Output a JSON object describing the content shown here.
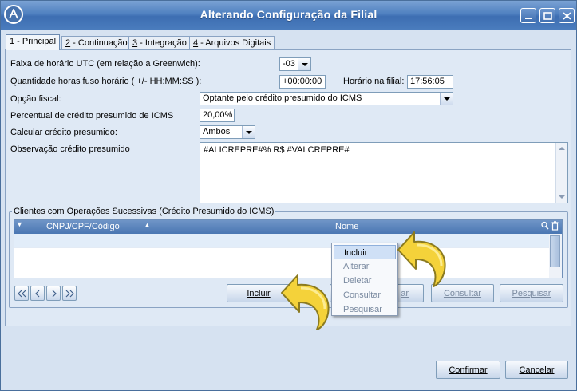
{
  "window": {
    "title": "Alterando Configuração da Filial"
  },
  "tabs": [
    {
      "key": "1",
      "label": " - Principal",
      "active": true
    },
    {
      "key": "2",
      "label": " - Continuação",
      "active": false
    },
    {
      "key": "3",
      "label": " - Integração",
      "active": false
    },
    {
      "key": "4",
      "label": " - Arquivos Digitais",
      "active": false
    }
  ],
  "form": {
    "utc_label": "Faixa de horário UTC (em relação a Greenwich):",
    "utc_value": "-03",
    "fuso_label": "Quantidade horas fuso horário ( +/- HH:MM:SS ):",
    "fuso_value": "+00:00:00",
    "horario_label": "Horário na filial:",
    "horario_value": "17:56:05",
    "opcao_label": "Opção fiscal:",
    "opcao_value": "Optante pelo crédito presumido do ICMS",
    "percentual_label": "Percentual de crédito presumido de ICMS",
    "percentual_value": "20,00%",
    "calcular_label": "Calcular crédito presumido:",
    "calcular_value": "Ambos",
    "obs_label": "Observação crédito presumido",
    "obs_value": "#ALICREPRE#% R$ #VALCREPRE#"
  },
  "clients": {
    "group_title": "Clientes com Operações Sucessivas (Crédito Presumido do ICMS)",
    "col_cnpj": "CNPJ/CPF/Código",
    "col_nome": "Nome"
  },
  "buttons": {
    "incluir": "Incluir",
    "alterar_partial": "ar",
    "consultar": "Consultar",
    "pesquisar": "Pesquisar",
    "confirmar": "Confirmar",
    "cancelar": "Cancelar"
  },
  "context_menu": [
    {
      "label": "Incluir",
      "state": "highlighted"
    },
    {
      "label": "Alterar",
      "state": "disabled"
    },
    {
      "label": "Deletar",
      "state": "disabled"
    },
    {
      "label": "Consultar",
      "state": "disabled"
    },
    {
      "label": "Pesquisar",
      "state": "disabled"
    }
  ],
  "icons": {
    "app": "app-logo-icon",
    "minimize": "minimize-icon",
    "maximize": "maximize-icon",
    "close": "close-icon",
    "nav_first": "first-record-icon",
    "nav_prev": "prev-record-icon",
    "nav_next": "next-record-icon",
    "nav_last": "last-record-icon",
    "pointer": "curved-arrow-pointer-icon"
  },
  "colors": {
    "titlebar": "#4f80c0",
    "panel": "#dfe9f5",
    "grid_header": "#4a76b2",
    "pointer_yellow": "#f4d23a"
  }
}
